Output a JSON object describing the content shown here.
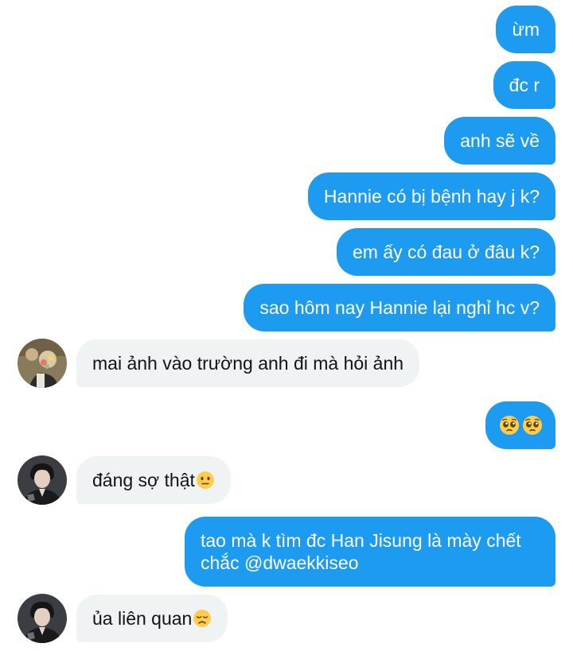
{
  "conversation": {
    "messages": [
      {
        "direction": "outgoing",
        "text": "ừm"
      },
      {
        "direction": "outgoing",
        "text": "đc r"
      },
      {
        "direction": "outgoing",
        "text": "anh sẽ về"
      },
      {
        "direction": "outgoing",
        "text": "Hannie có bị bệnh hay j k?"
      },
      {
        "direction": "outgoing",
        "text": "em ấy có đau ở đâu k?"
      },
      {
        "direction": "outgoing",
        "text": "sao hôm nay Hannie lại nghỉ hc v?"
      },
      {
        "direction": "incoming",
        "text": "mai ảnh vào trường anh đi mà hỏi ảnh",
        "avatar": "flowers-photo-avatar"
      },
      {
        "direction": "outgoing",
        "text": "",
        "emoji": [
          "pleading-face",
          "pleading-face"
        ]
      },
      {
        "direction": "incoming",
        "text": "đáng sợ thật",
        "emoji": [
          "neutral-face"
        ],
        "avatar": "person-suit-avatar"
      },
      {
        "direction": "outgoing",
        "text": "tao mà k tìm đc Han Jisung là mày chết chắc @dwaekkiseo"
      },
      {
        "direction": "incoming",
        "text": "ủa liên quan",
        "emoji": [
          "disappointed-face"
        ],
        "avatar": "person-suit-avatar"
      }
    ]
  },
  "colors": {
    "outgoing_bubble": "#1d9bf0",
    "incoming_bubble": "#eff3f4",
    "outgoing_text": "#ffffff",
    "incoming_text": "#0f1419",
    "emoji_yellow": "#ffcc4d"
  }
}
